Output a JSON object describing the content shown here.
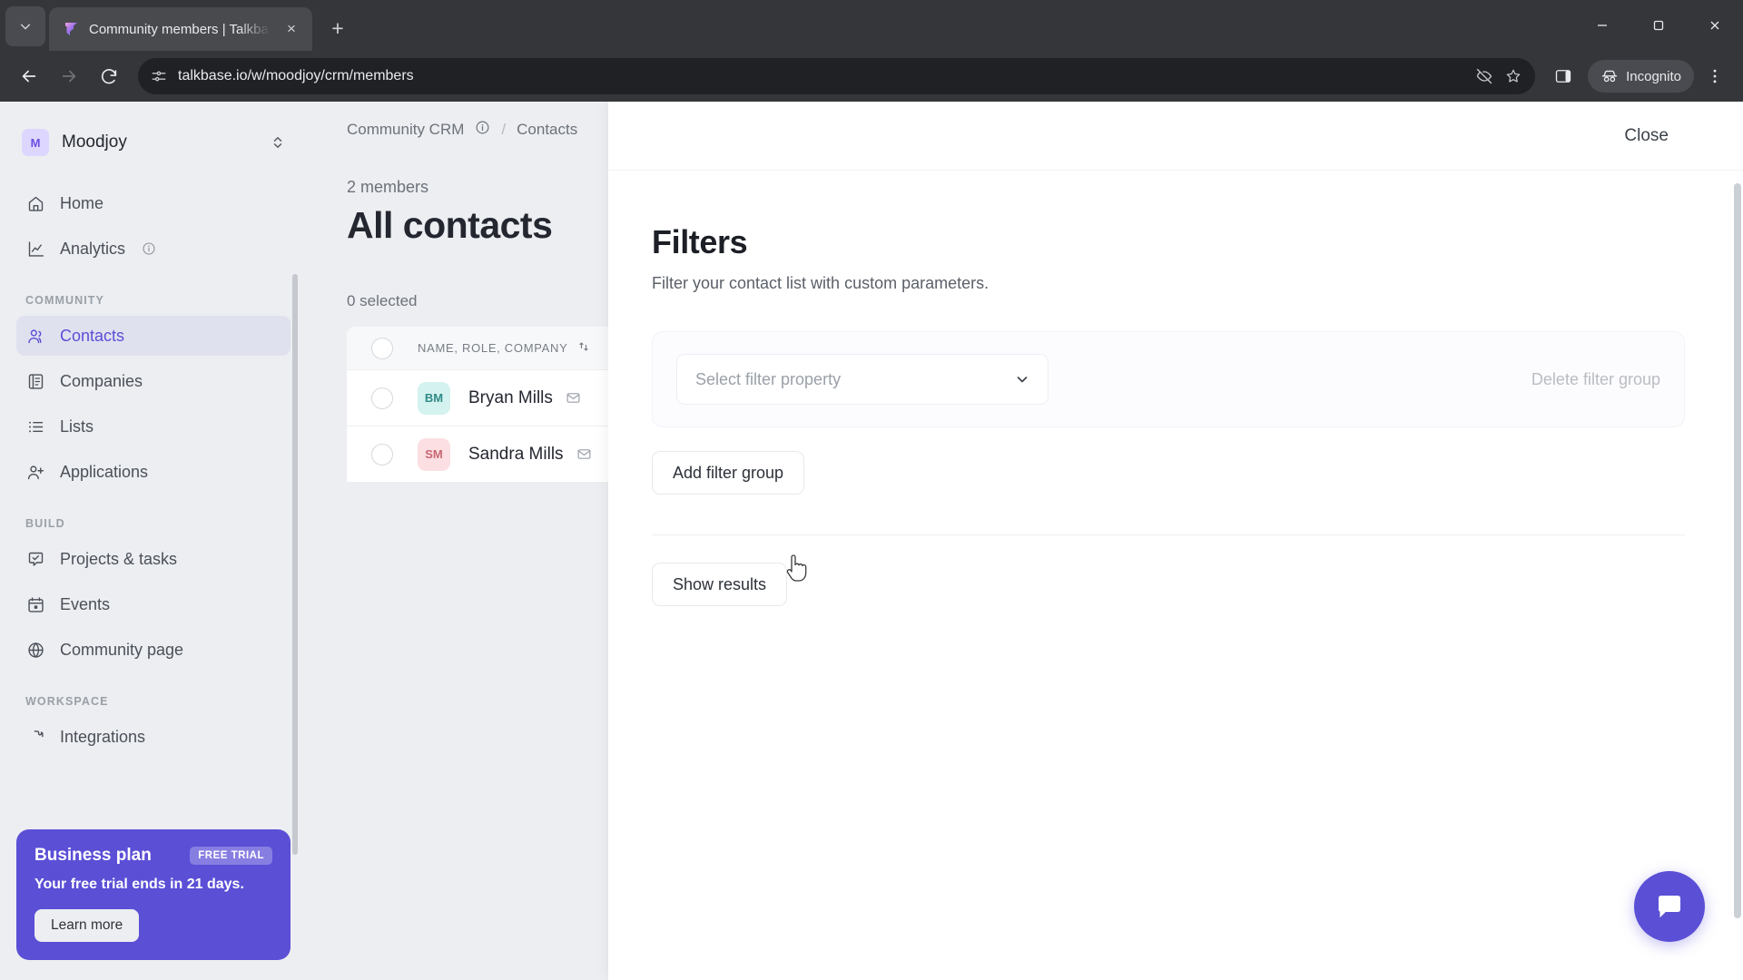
{
  "browser": {
    "tab": {
      "title": "Community members | Talkbase",
      "favicon": "talkbase-logo-icon",
      "close": "×"
    },
    "new_tab": "+",
    "tab_search": "chevron-down-icon",
    "url": "talkbase.io/w/moodjoy/crm/members",
    "profile_label": "Incognito",
    "window": {
      "minimize": "—",
      "maximize": "▢",
      "close": "✕"
    }
  },
  "sidebar": {
    "workspace": {
      "initial": "M",
      "name": "Moodjoy"
    },
    "top_items": [
      {
        "label": "Home",
        "icon": "home-icon"
      },
      {
        "label": "Analytics",
        "icon": "analytics-icon",
        "info": true
      }
    ],
    "groups": [
      {
        "title": "COMMUNITY",
        "items": [
          {
            "label": "Contacts",
            "icon": "contacts-icon",
            "active": true
          },
          {
            "label": "Companies",
            "icon": "companies-icon"
          },
          {
            "label": "Lists",
            "icon": "lists-icon"
          },
          {
            "label": "Applications",
            "icon": "applications-icon"
          }
        ]
      },
      {
        "title": "BUILD",
        "items": [
          {
            "label": "Projects & tasks",
            "icon": "tasks-icon"
          },
          {
            "label": "Events",
            "icon": "calendar-icon"
          },
          {
            "label": "Community page",
            "icon": "globe-icon"
          }
        ]
      },
      {
        "title": "WORKSPACE",
        "items": [
          {
            "label": "Integrations",
            "icon": "integrations-icon"
          }
        ]
      }
    ],
    "plan_card": {
      "title": "Business plan",
      "badge": "FREE TRIAL",
      "subtitle": "Your free trial ends in 21 days.",
      "button": "Learn more",
      "color": "#5b4fd6"
    }
  },
  "main": {
    "breadcrumb": {
      "root": "Community CRM",
      "separator": "/",
      "current": "Contacts"
    },
    "members_count": "2 members",
    "title": "All contacts",
    "selected_count": "0 selected",
    "table": {
      "columns": [
        "NAME, ROLE, COMPANY"
      ],
      "rows": [
        {
          "initials": "BM",
          "name": "Bryan Mills",
          "avatar_color": "#d4f2ef"
        },
        {
          "initials": "SM",
          "name": "Sandra Mills",
          "avatar_color": "#fbdfe2"
        }
      ]
    }
  },
  "drawer": {
    "close_label": "Close",
    "title": "Filters",
    "subtitle": "Filter your contact list with custom parameters.",
    "filter_group": {
      "select_placeholder": "Select filter property",
      "delete_label": "Delete filter group"
    },
    "add_group_label": "Add filter group",
    "show_results_label": "Show results"
  },
  "widgets": {
    "chat_bubble": "chat-icon"
  }
}
